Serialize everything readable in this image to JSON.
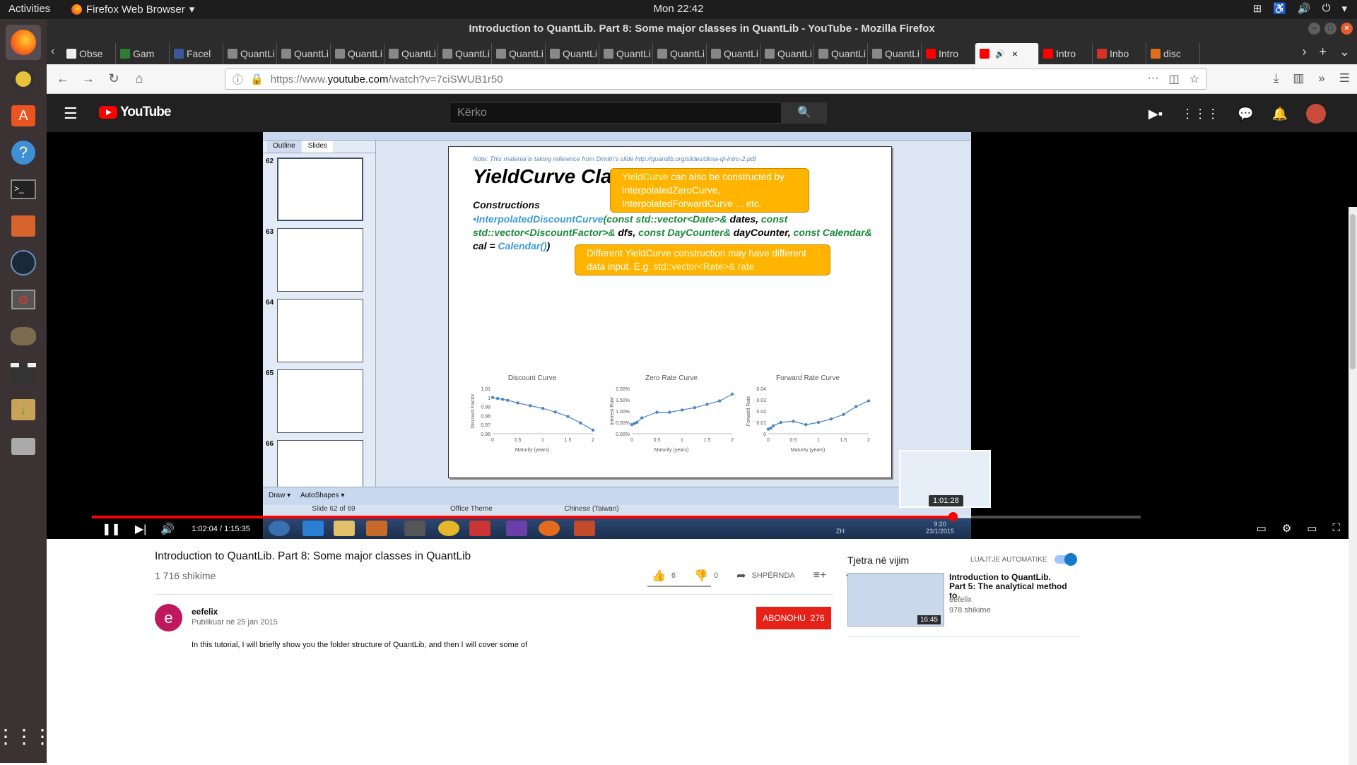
{
  "topbar": {
    "activities": "Activities",
    "app_name": "Firefox Web Browser",
    "clock": "Mon 22:42"
  },
  "window": {
    "title": "Introduction to QuantLib. Part 8: Some major classes in QuantLib - YouTube - Mozilla Firefox"
  },
  "tabs": [
    {
      "label": "Obse"
    },
    {
      "label": "Gam"
    },
    {
      "label": "Facel"
    },
    {
      "label": "QuantLi"
    },
    {
      "label": "QuantLi"
    },
    {
      "label": "QuantLi"
    },
    {
      "label": "QuantLi"
    },
    {
      "label": "QuantLi"
    },
    {
      "label": "QuantLi"
    },
    {
      "label": "QuantLi"
    },
    {
      "label": "QuantLi"
    },
    {
      "label": "QuantLi"
    },
    {
      "label": "QuantLi"
    },
    {
      "label": "QuantLi"
    },
    {
      "label": "QuantLi"
    },
    {
      "label": "QuantLi"
    },
    {
      "label": "Intro"
    },
    {
      "label": ""
    },
    {
      "label": "Intro"
    },
    {
      "label": "Inbo"
    },
    {
      "label": "disc"
    }
  ],
  "url": {
    "prefix": "https://www.",
    "domain": "youtube.com",
    "path": "/watch?v=7ciSWUB1r50"
  },
  "youtube": {
    "logo": "YouTube",
    "search_placeholder": "Kërko"
  },
  "slide": {
    "note": "Note: This material is taking reference from Dimitri's slide http://quantlib.org/slides/dima-ql-intro-2.pdf",
    "title": "YieldCurve Class",
    "constructions": "Constructions",
    "code_1": "•InterpolatedDiscountCurve",
    "code_2": "(const std::vector<Date>& ",
    "code_3": "dates, ",
    "code_4": "const std::vector<DiscountFactor>& ",
    "code_5": "dfs, ",
    "code_6": "const DayCounter& ",
    "code_7": "dayCounter, ",
    "code_8": "const Calendar& ",
    "code_9": "cal = ",
    "code_10": "Calendar()",
    "code_11": ")",
    "callout1_a": "YieldCurve",
    "callout1_b": " can also be constructed by InterpolatedZeroCurve, InterpolatedForwardCurve ... etc.",
    "callout2_a": "Different YieldCurve construction may have different data input. E.g. ",
    "callout2_b": "std::vector<Rate>& rate",
    "sidebar_tabs": [
      "Outline",
      "Slides"
    ],
    "thumb_numbers": [
      "62",
      "63",
      "64",
      "65",
      "66"
    ],
    "draw_label": "Draw ▾",
    "autoshapes_label": "AutoShapes ▾",
    "status": [
      "Slide 62 of 69",
      "Office Theme",
      "Chinese (Taiwan)"
    ],
    "win_tray_lang": "ZH",
    "win_time": "9:20",
    "win_date": "23/1/2015"
  },
  "chart_data": [
    {
      "type": "line",
      "title": "Discount Curve",
      "xlabel": "Maturity (years)",
      "ylabel": "Discount Factor",
      "x": [
        0,
        0.1,
        0.2,
        0.3,
        0.5,
        0.75,
        1,
        1.25,
        1.5,
        1.75,
        2
      ],
      "values": [
        1.0,
        0.999,
        0.998,
        0.997,
        0.994,
        0.991,
        0.988,
        0.984,
        0.979,
        0.972,
        0.964
      ],
      "ylim": [
        0.96,
        1.01
      ],
      "yticks": [
        "1.01",
        "1",
        "0.99",
        "0.98",
        "0.97",
        "0.96"
      ],
      "xticks": [
        "0",
        "0.5",
        "1",
        "1.5",
        "2"
      ]
    },
    {
      "type": "line",
      "title": "Zero Rate Curve",
      "xlabel": "Maturity (years)",
      "ylabel": "Interest Rate",
      "x": [
        0,
        0.05,
        0.1,
        0.2,
        0.5,
        0.75,
        1,
        1.25,
        1.5,
        1.75,
        2
      ],
      "values": [
        0.4,
        0.45,
        0.5,
        0.7,
        0.95,
        0.95,
        1.05,
        1.15,
        1.3,
        1.45,
        1.75
      ],
      "ylim": [
        0,
        2.0
      ],
      "yticks": [
        "2.00%",
        "1.50%",
        "1.00%",
        "0.50%",
        "0.00%"
      ],
      "xticks": [
        "0",
        "0.5",
        "1",
        "1.5",
        "2"
      ]
    },
    {
      "type": "line",
      "title": "Forward Rate Curve",
      "xlabel": "Maturity (years)",
      "ylabel": "Forward Rate",
      "x": [
        0,
        0.05,
        0.1,
        0.25,
        0.5,
        0.75,
        1,
        1.25,
        1.5,
        1.75,
        2
      ],
      "values": [
        0.004,
        0.005,
        0.007,
        0.01,
        0.011,
        0.008,
        0.01,
        0.013,
        0.017,
        0.024,
        0.029
      ],
      "ylim": [
        0,
        0.04
      ],
      "yticks": [
        "0.04",
        "0.03",
        "0.02",
        "0.01",
        "0"
      ],
      "xticks": [
        "0",
        "0.5",
        "1",
        "1.5",
        "2"
      ]
    }
  ],
  "player": {
    "current_time": "1:02:04",
    "duration": "1:15:35",
    "hover_time": "1:01:28",
    "progress": 0.821,
    "time_display": "1:02:04 / 1:15:35"
  },
  "video": {
    "title": "Introduction to QuantLib. Part 8: Some major classes in QuantLib",
    "views": "1 716 shikime",
    "likes": "6",
    "dislikes": "0",
    "share": "SHPËRNDA",
    "channel": "eefelix",
    "channel_initial": "e",
    "published": "Publikuar në 25 jan 2015",
    "subscribe": "ABONOHU",
    "subscribers": "276",
    "description": "In this tutorial, I will briefly show you the folder structure of QuantLib, and then I will cover some of"
  },
  "sidebar": {
    "up_next": "Tjetra në vijim",
    "autoplay": "LUAJTJE AUTOMATIKE",
    "next_title": "Introduction to QuantLib. Part 5: The analytical method to",
    "next_channel": "eefelix",
    "next_views": "978 shikime",
    "next_duration": "16:45"
  }
}
